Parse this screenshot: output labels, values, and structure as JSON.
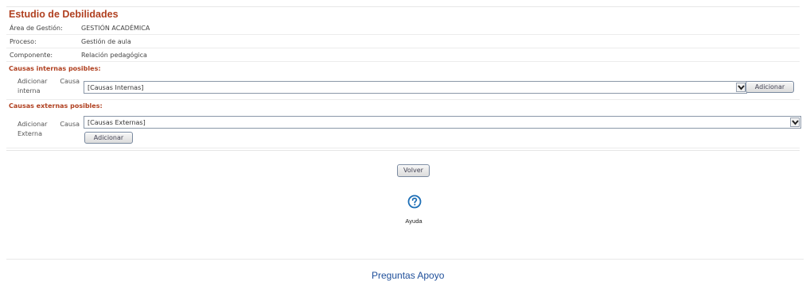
{
  "page": {
    "title": "Estudio de Debilidades"
  },
  "info": [
    {
      "label": "Área de Gestión:",
      "value": "GESTIÓN ACADÉMICA"
    },
    {
      "label": "Proceso:",
      "value": "Gestión de aula"
    },
    {
      "label": "Componente:",
      "value": "Relación pedagógica"
    }
  ],
  "internal": {
    "heading": "Causas internas posibles:",
    "add_label_1": "Adicionar",
    "add_label_2": "Causa",
    "add_label_3": "interna",
    "select_value": "[Causas Internas]",
    "button": "Adicionar"
  },
  "external": {
    "heading": "Causas externas posibles:",
    "add_label_1": "Adicionar",
    "add_label_2": "Causa",
    "add_label_3": "Externa",
    "select_value": "[Causas Externas]",
    "button": "Adicionar"
  },
  "actions": {
    "back": "Volver",
    "help_label": "Ayuda",
    "help_icon": "question-circle-icon"
  },
  "footer": {
    "link": "Preguntas Apoyo"
  },
  "colors": {
    "heading": "#b04020",
    "link": "#1f4f9a",
    "help_icon": "#1e6fb6"
  }
}
